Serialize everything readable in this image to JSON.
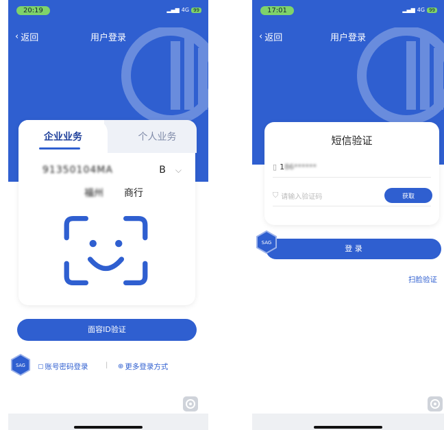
{
  "left": {
    "status": {
      "time": "20:19",
      "network": "4G",
      "battery": "99"
    },
    "nav": {
      "back_label": "返回",
      "title": "用户登录"
    },
    "tabs": {
      "enterprise": "企业业务",
      "personal": "个人业务"
    },
    "account": {
      "id": "91350104MA",
      "suffix": "B",
      "company_prefix": "福州",
      "company_suffix": "商行"
    },
    "face_button": "面容ID验证",
    "links": {
      "password_login": "账号密码登录",
      "separator": "|",
      "more_login": "更多登录方式"
    },
    "logo_text": "SAG"
  },
  "right": {
    "status": {
      "time": "17:01",
      "network": "4G",
      "battery": "99"
    },
    "nav": {
      "back_label": "返回",
      "title": "用户登录"
    },
    "card_title": "短信验证",
    "phone_value": "1",
    "phone_value_blur": "86******",
    "code_placeholder": "请输入验证码",
    "get_code": "获取",
    "login_button": "登 录",
    "scan_link": "扫脸验证",
    "logo_text": "SAG"
  },
  "colors": {
    "brand": "#2f5fd0",
    "accent_green": "#7fd36a"
  }
}
